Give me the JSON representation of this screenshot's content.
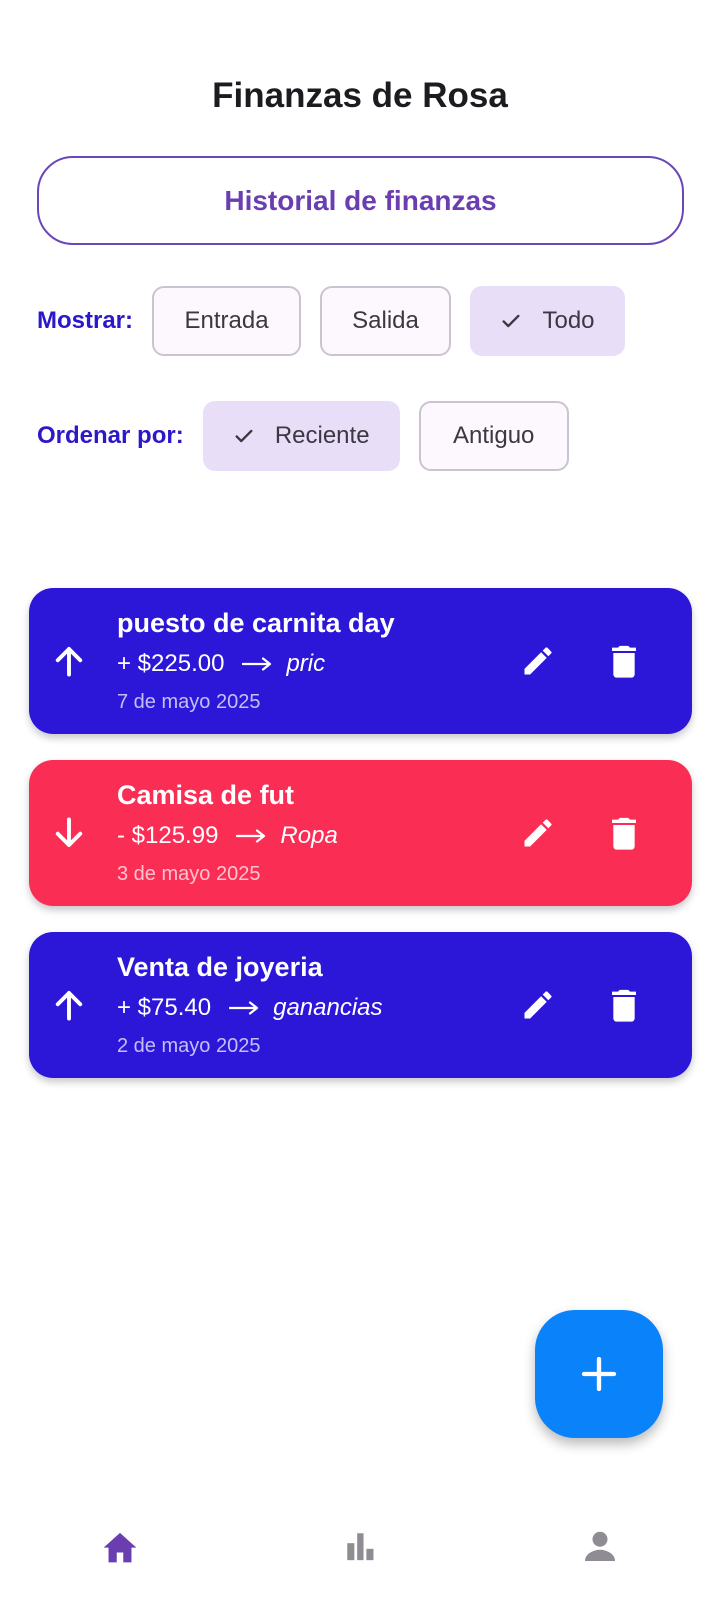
{
  "app": {
    "title": "Finanzas de Rosa"
  },
  "history_button": {
    "label": "Historial de finanzas"
  },
  "filters": {
    "show": {
      "label": "Mostrar:",
      "options": [
        "Entrada",
        "Salida",
        "Todo"
      ],
      "selected": "Todo"
    },
    "sort": {
      "label": "Ordenar por:",
      "options": [
        "Reciente",
        "Antiguo"
      ],
      "selected": "Reciente"
    }
  },
  "transactions": [
    {
      "name": "puesto de carnita day",
      "amount": "+ $225.00",
      "category": "pric",
      "date": "7 de mayo 2025",
      "type": "income",
      "direction_icon": "arrow-up-icon",
      "color": "#2c17d9"
    },
    {
      "name": "Camisa de fut",
      "amount": "- $125.99",
      "category": "Ropa",
      "date": "3 de mayo 2025",
      "type": "expense",
      "direction_icon": "arrow-down-icon",
      "color": "#fa2d55"
    },
    {
      "name": "Venta de joyeria",
      "amount": "+ $75.40",
      "category": "ganancias",
      "date": "2 de mayo 2025",
      "type": "income",
      "direction_icon": "arrow-up-icon",
      "color": "#2c17d9"
    }
  ],
  "fab": {
    "icon": "plus-icon",
    "color": "#0a82fa"
  },
  "bottom_nav": {
    "items": [
      {
        "icon": "home-icon",
        "active": true
      },
      {
        "icon": "bar-chart-icon",
        "active": false
      },
      {
        "icon": "person-icon",
        "active": false
      }
    ]
  },
  "colors": {
    "accent": "#6a3db0",
    "filter_label": "#2c17c9",
    "income": "#2c17d9",
    "expense": "#fa2d55"
  }
}
